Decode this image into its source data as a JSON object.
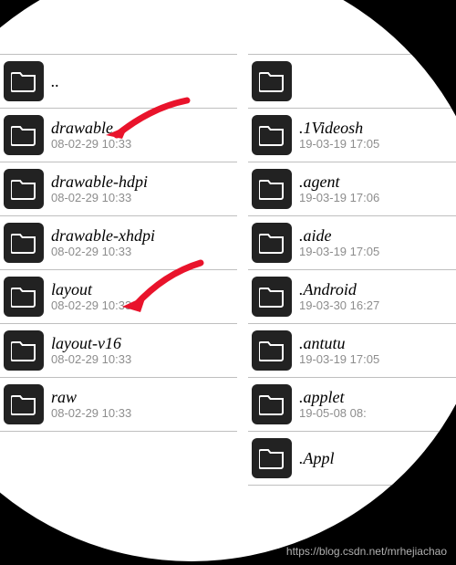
{
  "watermark": "https://blog.csdn.net/mrhejiachao",
  "left_col": {
    "items": [
      {
        "name": "..",
        "time": ""
      },
      {
        "name": "drawable",
        "time": "08-02-29 10:33"
      },
      {
        "name": "drawable-hdpi",
        "time": "08-02-29 10:33"
      },
      {
        "name": "drawable-xhdpi",
        "time": "08-02-29 10:33"
      },
      {
        "name": "layout",
        "time": "08-02-29 10:33"
      },
      {
        "name": "layout-v16",
        "time": "08-02-29 10:33"
      },
      {
        "name": "raw",
        "time": "08-02-29 10:33"
      }
    ]
  },
  "right_col": {
    "items": [
      {
        "name": "",
        "time": ""
      },
      {
        "name": ".1Videosh",
        "time": "19-03-19 17:05"
      },
      {
        "name": ".agent",
        "time": "19-03-19 17:06"
      },
      {
        "name": ".aide",
        "time": "19-03-19 17:05"
      },
      {
        "name": ".Android",
        "time": "19-03-30 16:27"
      },
      {
        "name": ".antutu",
        "time": "19-03-19 17:05"
      },
      {
        "name": ".applet",
        "time": "19-05-08 08:"
      },
      {
        "name": ".Appl",
        "time": ""
      }
    ]
  },
  "arrow_color": "#e9132b"
}
